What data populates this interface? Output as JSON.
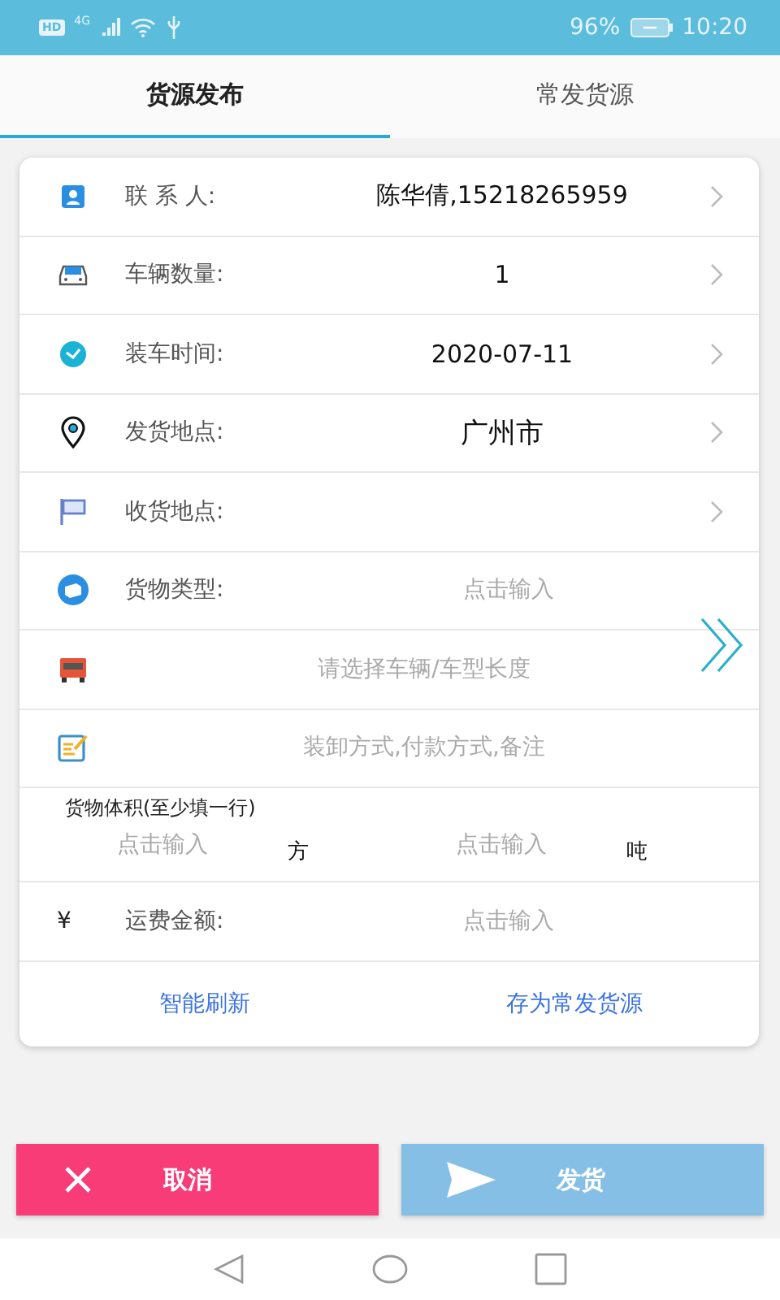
{
  "status_bar": {
    "hd": "HD",
    "network": "4G",
    "battery": "96%",
    "time": "10:20"
  },
  "tabs": [
    {
      "label": "货源发布",
      "selected": true
    },
    {
      "label": "常发货源",
      "selected": false
    }
  ],
  "rows": [
    {
      "kind": "field",
      "label": "联 系 人:",
      "value": "陈华倩,15218265959",
      "chevron": true
    },
    {
      "kind": "field",
      "label": "车辆数量:",
      "value": "1",
      "chevron": true
    },
    {
      "kind": "field",
      "label": "装车时间:",
      "value": "2020-07-11",
      "chevron": true
    },
    {
      "kind": "field",
      "label": "发货地点:",
      "value": "广州市",
      "chevron": true
    },
    {
      "kind": "field",
      "label": "收货地点:",
      "chevron": true
    },
    {
      "kind": "field",
      "label": "货物类型:",
      "placeholder": "点击输入",
      "chevron": false
    },
    {
      "kind": "wide",
      "placeholder": "请选择车辆/车型长度",
      "chevron": false
    },
    {
      "kind": "wide",
      "placeholder": "装卸方式,付款方式,备注",
      "chevron": false
    }
  ],
  "volume": {
    "title": "货物体积(至少填一行)",
    "inputs": [
      {
        "placeholder": "点击输入",
        "unit": "方"
      },
      {
        "placeholder": "点击输入",
        "unit": "吨"
      }
    ]
  },
  "freight": {
    "symbol": "¥",
    "label": "运费金额:",
    "placeholder": "点击输入"
  },
  "links": [
    "智能刷新",
    "存为常发货源"
  ],
  "buttons": [
    {
      "kind": "cancel",
      "label": "取消"
    },
    {
      "kind": "send",
      "label": "发货"
    }
  ]
}
